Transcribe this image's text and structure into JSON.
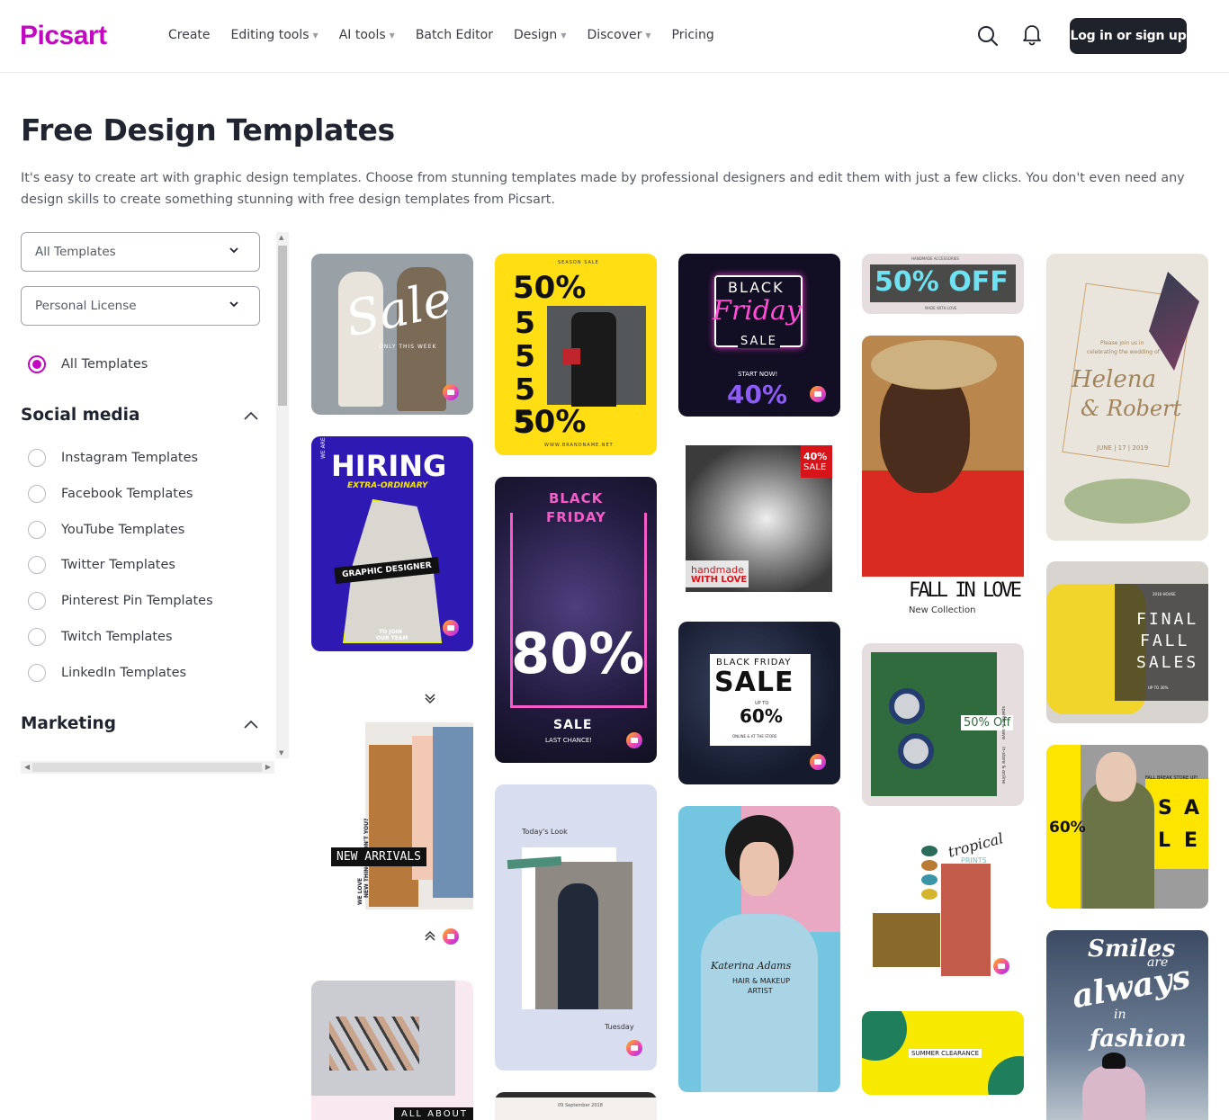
{
  "brand": {
    "name": "Picsart",
    "accent": "#c209c1"
  },
  "nav": {
    "items": [
      {
        "label": "Create",
        "dropdown": false
      },
      {
        "label": "Editing tools",
        "dropdown": true
      },
      {
        "label": "AI tools",
        "dropdown": true
      },
      {
        "label": "Batch Editor",
        "dropdown": false
      },
      {
        "label": "Design",
        "dropdown": true
      },
      {
        "label": "Discover",
        "dropdown": true
      },
      {
        "label": "Pricing",
        "dropdown": false
      }
    ],
    "search_icon": "search-icon",
    "bell_icon": "bell-icon",
    "login_label": "Log in or sign up"
  },
  "page": {
    "title": "Free Design Templates",
    "intro": "It's easy to create art with graphic design templates. Choose from stunning templates made by professional designers and edit them with just a few clicks. You don't even need any design skills to create something stunning with free design templates from Picsart."
  },
  "filters": {
    "category_select": "All Templates",
    "license_select": "Personal License",
    "all_templates_label": "All Templates",
    "social": {
      "title": "Social media",
      "items": [
        "Instagram Templates",
        "Facebook Templates",
        "YouTube Templates",
        "Twitter Templates",
        "Pinterest Pin Templates",
        "Twitch Templates",
        "LinkedIn Templates"
      ]
    },
    "marketing": {
      "title": "Marketing"
    }
  },
  "templates": {
    "t1": {
      "script": "Sale",
      "sub": "ONLY THIS WEEK"
    },
    "t2": {
      "top": "SEASON SALE",
      "big": "50%",
      "digits": "5555",
      "bottom": "50%",
      "url": "WWW.BRANDNAME.NET"
    },
    "t3": {
      "l1": "BLACK",
      "l2": "Friday",
      "l3": "SALE",
      "l4": "START NOW!",
      "l5": "40%"
    },
    "t4": {
      "sub": "HANDMADE ACCESSORIES",
      "big": "50% OFF",
      "bottom": "MADE WITH LOVE"
    },
    "t5": {
      "l1": "Please join us in",
      "l2": "celebrating the wedding of",
      "n1": "Helena",
      "n2": "& Robert",
      "date": "JUNE | 17 | 2019"
    },
    "t6": {
      "side": "WE ARE",
      "big": "HIRING",
      "sub": "EXTRA-ORDINARY",
      "role": "GRAPHIC DESIGNER",
      "join1": "TO JOIN",
      "join2": "OUR TEAM"
    },
    "t7": {
      "l1": "BLACK",
      "l2": "FRIDAY",
      "big": "80%",
      "sale": "SALE",
      "last": "LAST CHANCE!"
    },
    "t8": {
      "tag1": "40%",
      "tag2": "SALE",
      "hand": "handmade",
      "love": "WITH LOVE"
    },
    "t9": {
      "l1": "FALL IN LOVE",
      "l2": "New Collection"
    },
    "t10": {
      "side1": "NEW THINGS, DON'T YOU?",
      "side2": "WE LOVE",
      "big": "NEW ARRIVALS"
    },
    "t11": {
      "l1": "BLACK FRIDAY",
      "l2": "SALE",
      "l3": "UP TO",
      "l4": "60%",
      "l5": "ONLINE & AT THE STORE"
    },
    "t12": {
      "brand": "2016 HOUSE",
      "l1": "FINAL",
      "l2": "FALL",
      "l3": "SALES",
      "l4": "UP TO 30%"
    },
    "t13": {
      "badge": "50% Off",
      "side1": "sparkle & save",
      "side2": "in-store & online"
    },
    "t14": {
      "top": "Today's Look",
      "bottom": "Tuesday"
    },
    "t15": {
      "name": "Katerina Adams",
      "role1": "HAIR & MAKEUP",
      "role2": "ARTIST"
    },
    "t16": {
      "top": "FALL BREAK STORE UP!",
      "pct": "60%",
      "s": "S",
      "a": "A",
      "l": "L",
      "e": "E"
    },
    "t17": {
      "script": "tropical",
      "sub": "PRINTS"
    },
    "t18": {
      "l1": "Smiles",
      "l2": "are",
      "l3": "always",
      "l4": "in",
      "l5": "fashion"
    },
    "t19": {
      "label": "SUMMER CLEARANCE"
    },
    "t20": {
      "label": "ALL ABOUT"
    },
    "t21": {
      "label": "09 September 2018"
    }
  }
}
